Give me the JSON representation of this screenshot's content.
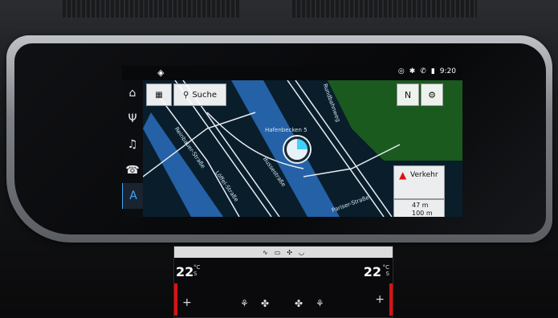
{
  "status": {
    "app_icon": "cube-icon",
    "time": "9:20",
    "icons": [
      "nav-icon",
      "bluetooth-icon",
      "phone-icon",
      "signal-icon"
    ]
  },
  "sidebar": {
    "items": [
      {
        "icon": "home-icon",
        "glyph": "⌂"
      },
      {
        "icon": "radio-icon",
        "glyph": "Ψ"
      },
      {
        "icon": "music-icon",
        "glyph": "♫"
      },
      {
        "icon": "phone-icon",
        "glyph": "☎"
      },
      {
        "icon": "navigation-icon",
        "glyph": "A",
        "active": true
      }
    ]
  },
  "toolbar": {
    "search_label": "Suche",
    "compass_label": "N",
    "settings_glyph": "⚙"
  },
  "map": {
    "location_label": "Hafenbecken 5",
    "streets": [
      "Reinbauer-Straße",
      "Löffel-Straße",
      "Bussestraße",
      "Rundbahnweg",
      "Pariser-Straße"
    ]
  },
  "traffic": {
    "label": "Verkehr"
  },
  "distance": {
    "a": "47",
    "a_unit": "m",
    "b": "100",
    "b_unit": "m"
  },
  "climate": {
    "left_temp": "22",
    "right_temp": "22",
    "unit": "°C",
    "left_sub": "S",
    "right_sub": "S",
    "plus": "+"
  },
  "colors": {
    "accent": "#3fa9f5",
    "map_water": "#2561a6",
    "map_green": "#1a5a1f",
    "map_bg": "#0a1d2b"
  }
}
